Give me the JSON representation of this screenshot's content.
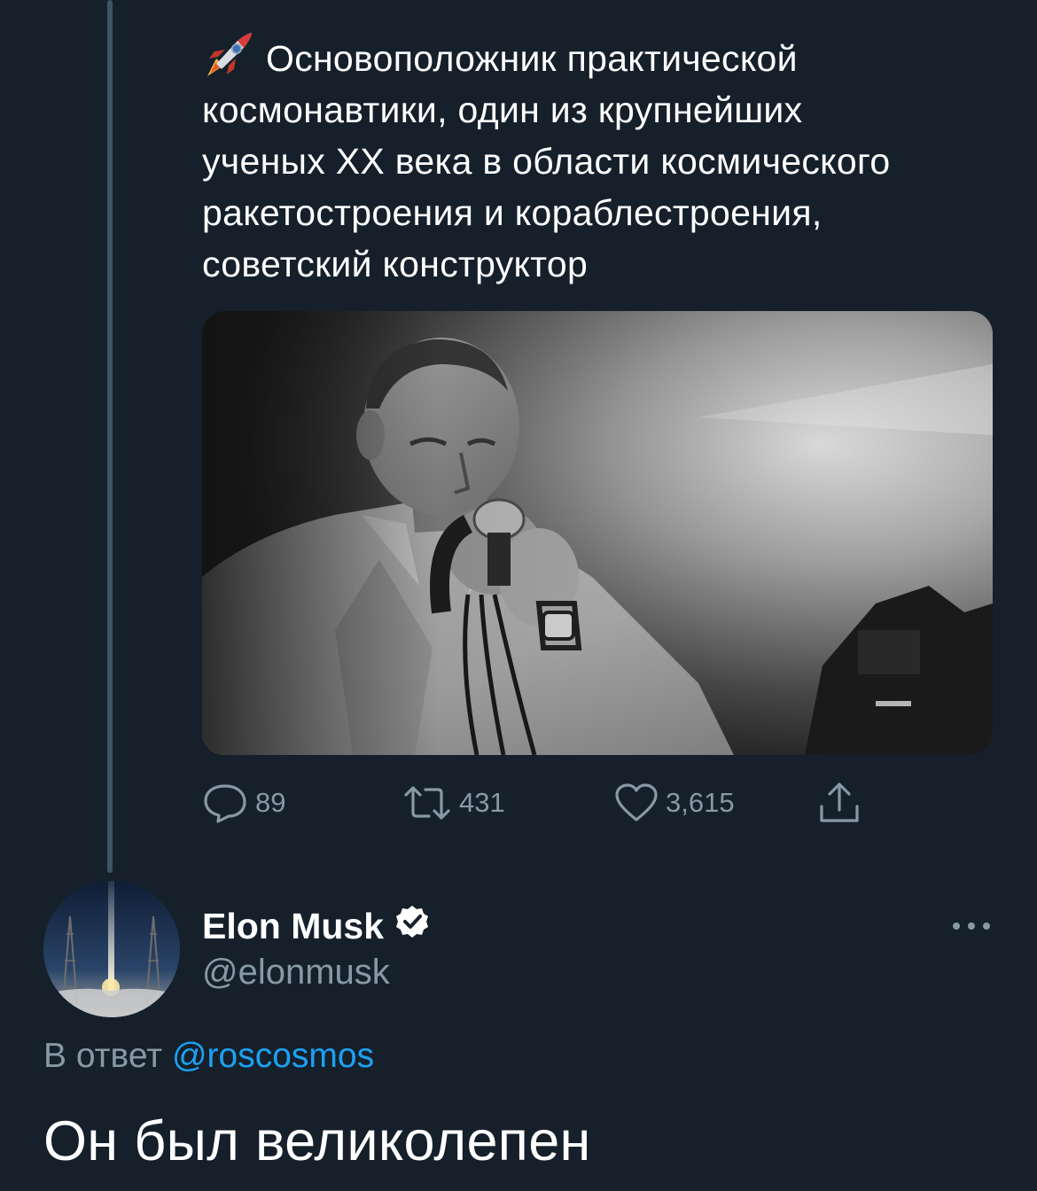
{
  "quoted_tweet": {
    "text": "Основоположник практической космонавтики, один из крупнейших ученых XX века в области космического ракетостроения и кораблестроения, советский конструктор",
    "lines": [
      "Основоположник практической",
      "космонавтики, один из крупнейших",
      "ученых XX века в области космического",
      "ракетостроения и кораблестроения,",
      "советский конструктор"
    ],
    "emoji_icon": "rocket-icon",
    "photo_icon": "photo-portrait-man-microphone",
    "stats": {
      "replies": "89",
      "retweets": "431",
      "likes": "3,615"
    }
  },
  "reply_tweet": {
    "author_name": "Elon Musk",
    "author_handle": "@elonmusk",
    "verified": true,
    "reply_prefix": "В ответ",
    "reply_mention": "@roscosmos",
    "text": "Он был великолепен"
  },
  "colors": {
    "background": "#15202b",
    "text_primary": "#ffffff",
    "text_secondary": "#8899a6",
    "link": "#1da1f2",
    "thread_line": "#3d5466"
  }
}
